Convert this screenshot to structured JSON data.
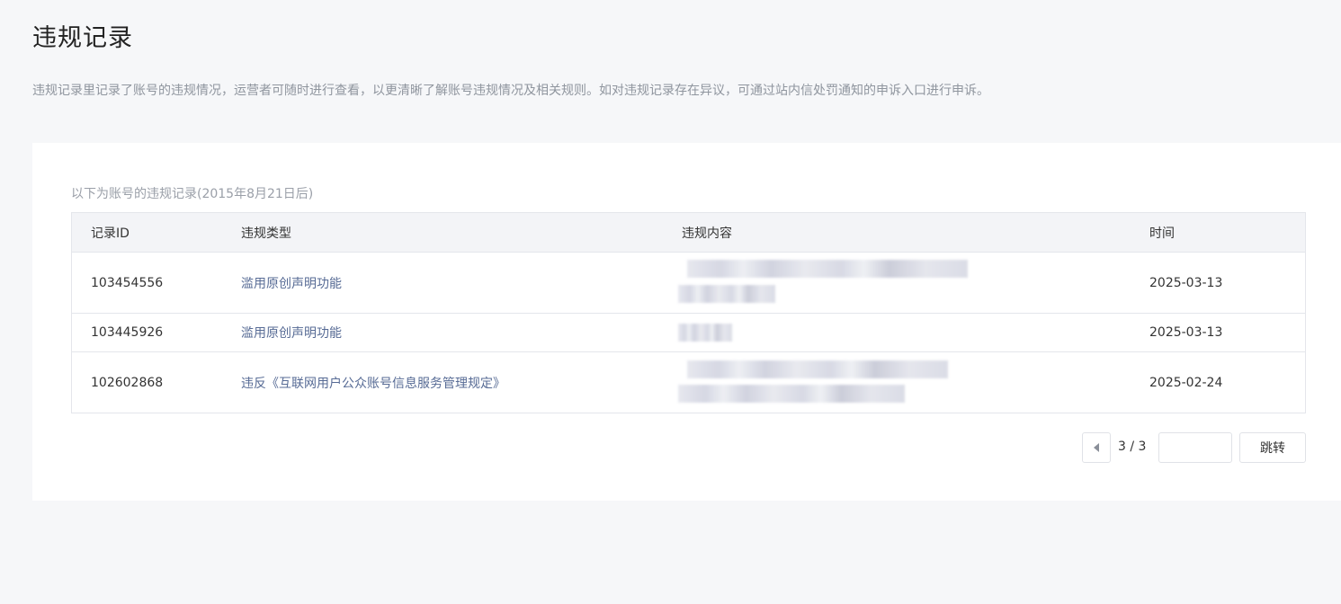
{
  "header": {
    "title": "违规记录",
    "description": "违规记录里记录了账号的违规情况，运营者可随时进行查看，以更清晰了解账号违规情况及相关规则。如对违规记录存在异议，可通过站内信处罚通知的申诉入口进行申诉。"
  },
  "card": {
    "caption": "以下为账号的违规记录(2015年8月21日后)"
  },
  "table": {
    "columns": {
      "id": "记录ID",
      "type": "违规类型",
      "content": "违规内容",
      "time": "时间"
    },
    "rows": [
      {
        "id": "103454556",
        "type": "滥用原创声明功能",
        "time": "2025-03-13"
      },
      {
        "id": "103445926",
        "type": "滥用原创声明功能",
        "time": "2025-03-13"
      },
      {
        "id": "102602868",
        "type": "违反《互联网用户公众账号信息服务管理规定》",
        "time": "2025-02-24"
      }
    ]
  },
  "pagination": {
    "info": "3 / 3",
    "input_value": "",
    "jump_label": "跳转"
  }
}
